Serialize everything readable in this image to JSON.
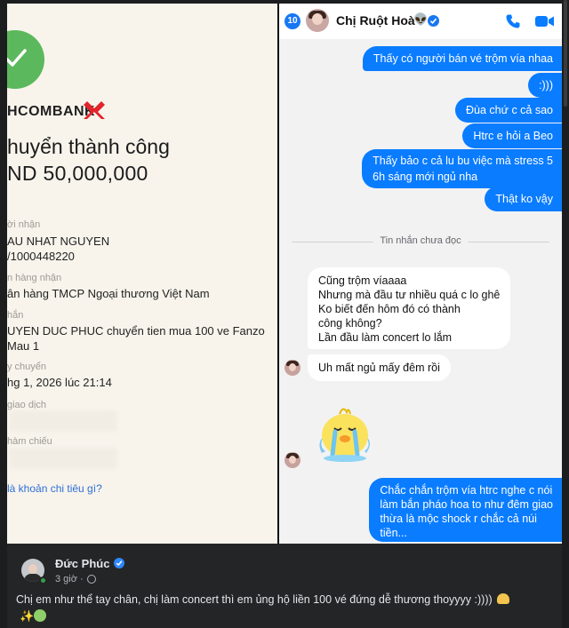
{
  "receipt": {
    "bank_name": "HCOMBANK",
    "title": "huyển thành công",
    "amount": "ND 50,000,000",
    "recipient_label": "ời nhận",
    "recipient_name": "AU NHAT NGUYEN",
    "recipient_account": "/1000448220",
    "bank_label": "n hàng nhận",
    "bank_value": "ân hàng TMCP Ngoại thương Việt Nam",
    "content_label": "hắn",
    "content_line1": "UYEN DUC PHUC chuyển tien mua 100 ve Fanzo",
    "content_line2": "Mau 1",
    "time_label": "y chuyển",
    "time_value": "hg 1, 2026 lúc 21:14",
    "txn_label": "giao dịch",
    "ref_label": "hàm chiếu",
    "link_text": "là khoản chi tiêu gì?",
    "success_color": "#5cb85c"
  },
  "chat": {
    "unread_count": "10",
    "contact_name": "Chị Ruột Hoà",
    "contact_emoji": "👽",
    "accent": "#0a7cff",
    "outgoing": [
      "Thấy có người bán vé trộm vía nhaa",
      ":)))",
      "Đùa chứ c cả sao",
      "Htrc e hỏi a Beo",
      "Thấy bảo c cả lu bu việc mà stress 5",
      "6h sáng mới ngủ nha",
      "Thật ko vậy"
    ],
    "unread_divider": "Tin nhắn chưa đọc",
    "incoming": [
      "Cũng trộm víaaaa",
      "Nhưng mà đầu tư nhiều quá c lo ghê",
      "Ko biết đến hôm đó có thành",
      "công không?",
      "Lần đầu làm concert lo lắm",
      "Uh mất ngủ mấy đêm rồi"
    ],
    "final_out": [
      "Chắc chắn trộm vía htrc nghe c nói",
      "làm bắn pháo hoa to như đêm giao",
      "thừa là mộc shock r chắc cả núi",
      "tiền..."
    ]
  },
  "post": {
    "author": "Đức Phúc",
    "time": "3 giờ ·",
    "text": "Chị em như thể tay chân, chị làm concert thì em ủng hộ liền 100 vé đứng dễ thương thoyyyy :))))",
    "emoji_line": "✨"
  }
}
